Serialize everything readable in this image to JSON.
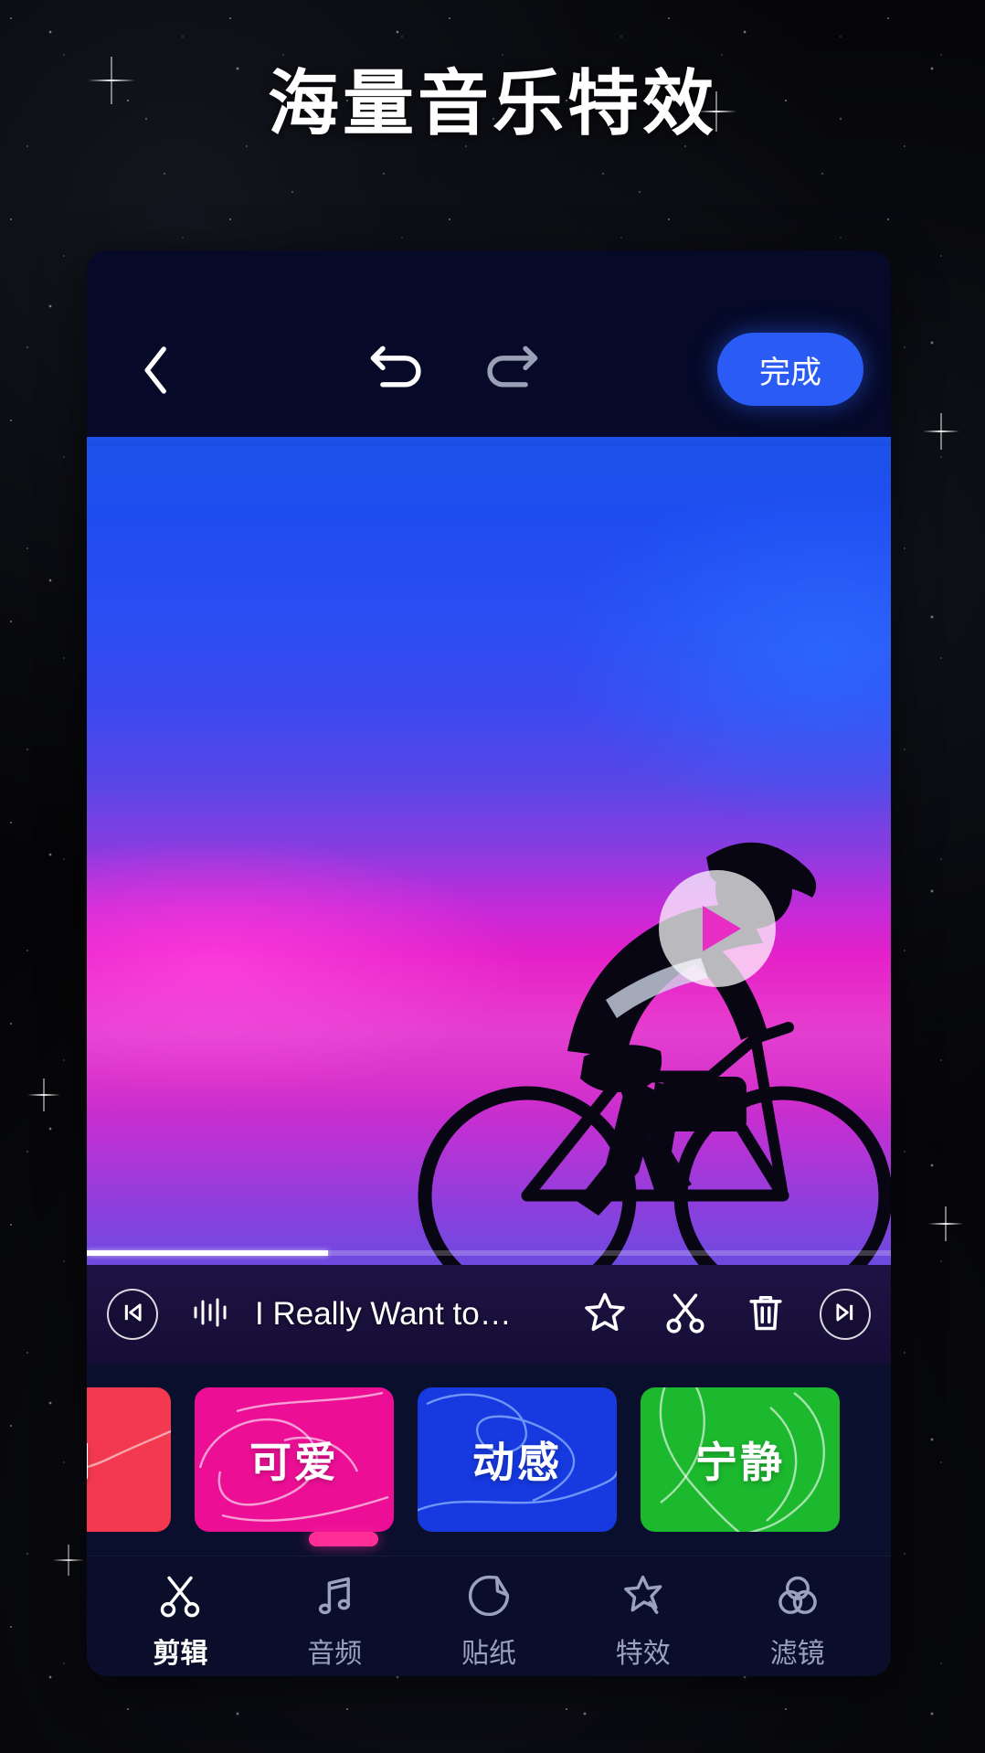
{
  "hero": {
    "title": "海量音乐特效"
  },
  "colors": {
    "accent_blue": "#2a5cf5",
    "accent_pink": "#ff2d96",
    "card_red": "#f2394f",
    "card_pink": "#ec0f96",
    "card_blue": "#1639e0",
    "card_green": "#1cb82e",
    "panel_navy": "#0b0f2e",
    "topbar_navy": "#060a28",
    "nav_inactive": "#9aa2bd",
    "nav_active": "#ffffff",
    "redo_disabled": "#9aa0b5"
  },
  "topbar": {
    "back_icon": "chevron-left-icon",
    "undo_icon": "undo-arrow-icon",
    "redo_icon": "redo-arrow-icon",
    "redo_disabled": true,
    "done_label": "完成"
  },
  "video": {
    "play_icon": "play-icon",
    "progress_percent": 30,
    "subject": "cyclist-silhouette"
  },
  "music_track": {
    "skip_start_icon": "skip-to-start-icon",
    "waveform_icon": "waveform-icon",
    "title": "I Really Want to…",
    "favorite_icon": "star-icon",
    "cut_icon": "scissors-icon",
    "delete_icon": "trash-icon",
    "skip_end_icon": "skip-to-end-icon"
  },
  "style_cards": [
    {
      "label": "闹",
      "color": "#f2394f",
      "clipped": true
    },
    {
      "label": "可爱",
      "color": "#ec0f96",
      "clipped": false
    },
    {
      "label": "动感",
      "color": "#1639e0",
      "clipped": false
    },
    {
      "label": "宁静",
      "color": "#1cb82e",
      "clipped": false
    }
  ],
  "bottom_nav": {
    "items": [
      {
        "label": "剪辑",
        "icon": "scissors-icon",
        "active": true
      },
      {
        "label": "音频",
        "icon": "music-note-icon",
        "active": false
      },
      {
        "label": "贴纸",
        "icon": "sticker-icon",
        "active": false
      },
      {
        "label": "特效",
        "icon": "star-effect-icon",
        "active": false
      },
      {
        "label": "滤镜",
        "icon": "filter-circles-icon",
        "active": false
      }
    ]
  }
}
